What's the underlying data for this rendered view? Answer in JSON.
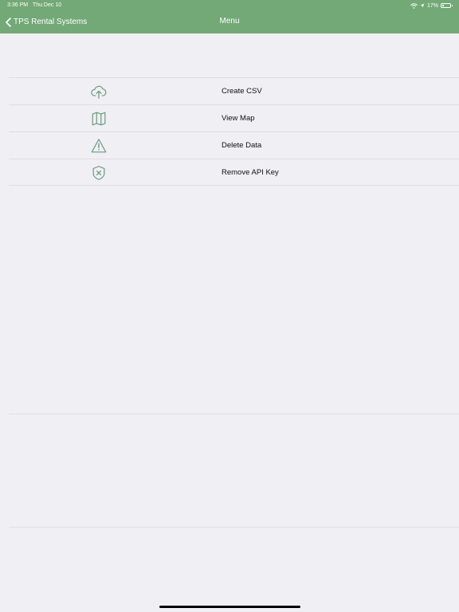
{
  "status_bar": {
    "time": "3:36 PM",
    "date": "Thu Dec 10",
    "battery": "17%",
    "icons": [
      "wifi-icon",
      "location-icon",
      "battery-icon"
    ]
  },
  "nav": {
    "back_label": "TPS Rental Systems",
    "title": "Menu",
    "back_icon": "chevron-left-icon"
  },
  "menu": {
    "items": [
      {
        "label": "Create CSV",
        "icon": "cloud-upload-icon"
      },
      {
        "label": "View Map",
        "icon": "map-icon"
      },
      {
        "label": "Delete Data",
        "icon": "warning-triangle-icon"
      },
      {
        "label": "Remove API Key",
        "icon": "shield-x-icon"
      }
    ]
  },
  "colors": {
    "nav_background": "#73a977",
    "icon": "#6b9a7c",
    "background": "#f0eff4"
  }
}
